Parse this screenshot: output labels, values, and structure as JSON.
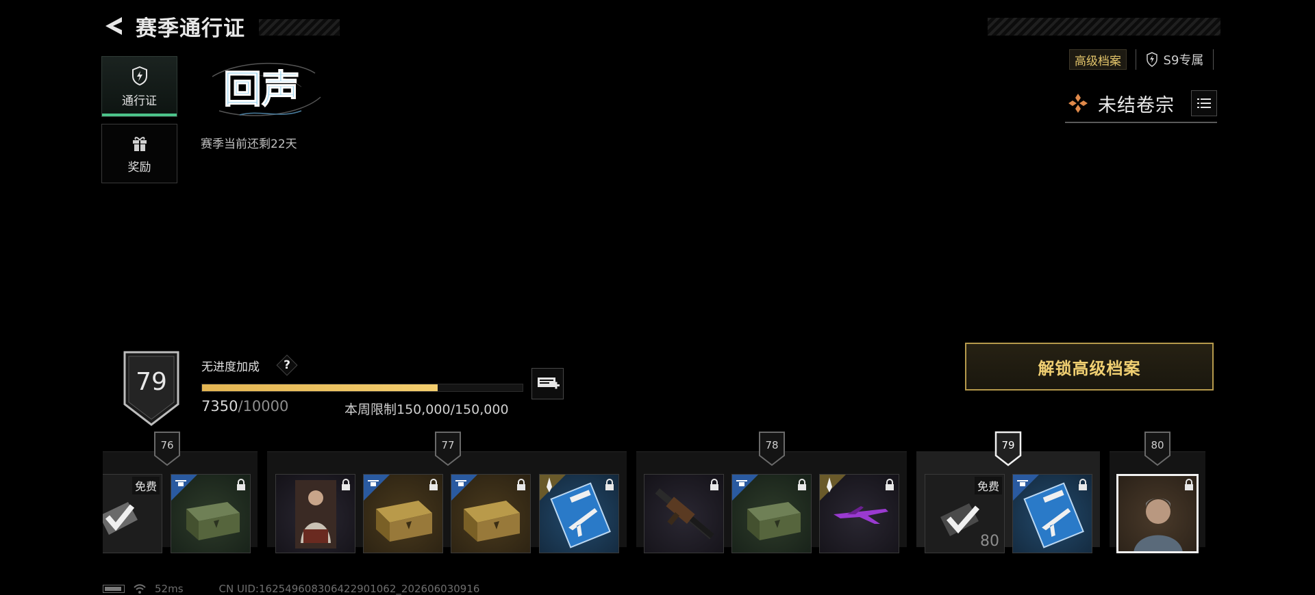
{
  "header": {
    "title": "赛季通行证"
  },
  "nav": {
    "pass_label": "通行证",
    "rewards_label": "奖励"
  },
  "season": {
    "logo_text": "回声",
    "remaining": "赛季当前还剩22天"
  },
  "top_right": {
    "premium_chip": "高级档案",
    "exclusive_chip": "S9专属",
    "case_title": "未结卷宗"
  },
  "progress": {
    "level": "79",
    "bonus_label": "无进度加成",
    "help": "?",
    "xp_current": "7350",
    "xp_max": "/10000",
    "xp_fraction": 0.735,
    "weekly_limit": "本周限制150,000/150,000"
  },
  "unlock_button": "解锁高级档案",
  "tiers": [
    {
      "level": "76",
      "free_label": "免费"
    },
    {
      "level": "77"
    },
    {
      "level": "78"
    },
    {
      "level": "79",
      "free_label": "免费",
      "free_card_level": "80"
    },
    {
      "level": "80"
    }
  ],
  "statusbar": {
    "ping": "52ms",
    "uid": "CN UID:1625496083064229010​62_202606030916"
  },
  "colors": {
    "accent_gold": "#e3b552",
    "active_green": "#4cc48a",
    "premium_text": "#e2c46a"
  }
}
